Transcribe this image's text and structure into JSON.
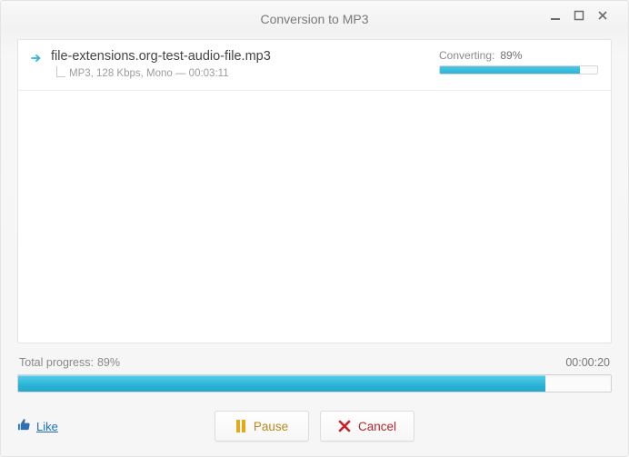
{
  "window": {
    "title": "Conversion to MP3"
  },
  "files": [
    {
      "name": "file-extensions.org-test-audio-file.mp3",
      "meta": "MP3, 128 Kbps, Mono — 00:03:11",
      "status_label": "Converting:",
      "percent_text": "89%",
      "percent": 89
    }
  ],
  "total": {
    "label": "Total progress:",
    "percent_text": "89%",
    "percent": 89,
    "elapsed": "00:00:20"
  },
  "actions": {
    "like": "Like",
    "pause": "Pause",
    "cancel": "Cancel"
  },
  "colors": {
    "accent": "#2bb4d6",
    "pause": "#e6a817",
    "cancel": "#cc1f27",
    "link": "#1a6fc4"
  }
}
